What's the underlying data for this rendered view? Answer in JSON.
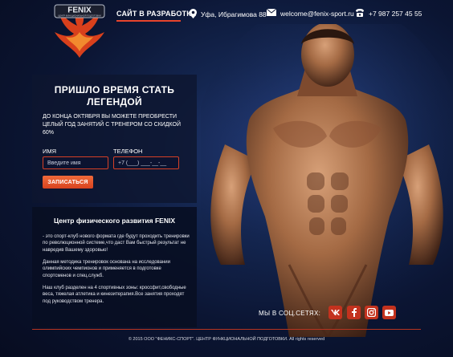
{
  "header": {
    "logo_text": "FENIX",
    "logo_subtitle": "ЦЕНТР ФУНКЦИОНАЛЬНОЙ ПОДГОТОВКИ",
    "nav_link": "САЙТ В РАЗРАБОТКЕ",
    "address": "Уфа, Ибрагимова 88",
    "email": "welcome@fenix-sport.ru",
    "phone": "+7 987 257 45 55"
  },
  "promo": {
    "title_line1": "ПРИШЛО ВРЕМЯ СТАТЬ",
    "title_line2": "ЛЕГЕНДОЙ",
    "text": "ДО КОНЦА ОКТЯБРЯ ВЫ МОЖЕТЕ ПРЕОБРЕСТИ ЦЕЛЫЙ ГОД ЗАНЯТИЙ С ТРЕНЕРОМ СО СКИДКОЙ 60%"
  },
  "form": {
    "name_label": "ИМЯ",
    "name_placeholder": "Введите имя",
    "phone_label": "ТЕЛЕФОН",
    "phone_placeholder": "+7 (___) ___-__-__",
    "submit_label": "ЗАПИСАТЬСЯ"
  },
  "info": {
    "title": "Центр физического развития FENIX",
    "p1": "- это спорт-клуб нового формата где будут проходить тренировки по революционной системе,что даст Вам быстрый результат не навредив Вашему здоровью!",
    "p2": "Данная методика тренировок основана на исследовании олимпийских чемпионов и применяется в подготовке спортсменов и спец.служб.",
    "p3": "Наш клуб разделен на 4 спортивных зоны: кроссфит,свободные веса, тяжелая атлетика и кинезитерапия.Все занятия проходят под руководством тренера."
  },
  "social": {
    "label": "МЫ В СОЦ.СЕТЯХ:",
    "icons": [
      "vk-icon",
      "facebook-icon",
      "instagram-icon",
      "youtube-icon"
    ]
  },
  "footer": {
    "text": "© 2015 ООО \"ФЕНИКС-СПОРТ\". ЦЕНТР ФУНКЦИОНАЛЬНОЙ ПОДГОТОВКИ. All rights reserved"
  },
  "colors": {
    "accent": "#e8442c",
    "background": "#0b1533",
    "panel": "#0e1630"
  }
}
